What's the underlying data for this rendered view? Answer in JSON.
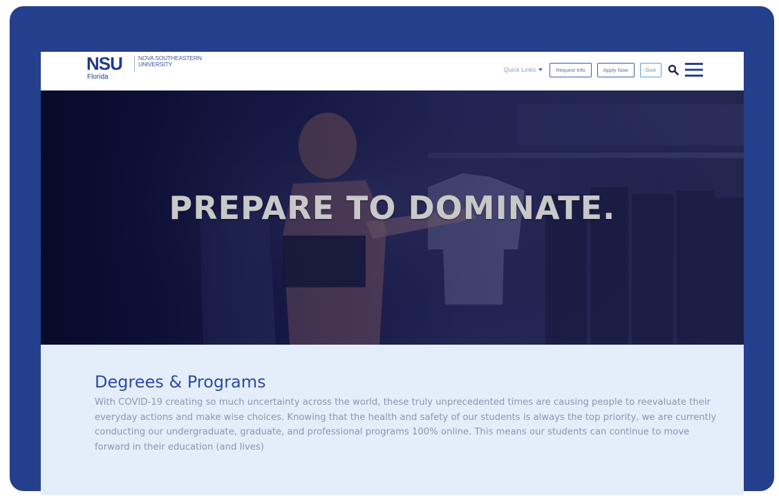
{
  "header": {
    "logo_mark": "NSU",
    "logo_name": "NOVA SOUTHEASTERN UNIVERSITY",
    "logo_sub": "Florida",
    "nav": {
      "quick_links": "Quick Links",
      "request_info": "Request Info",
      "apply_now": "Apply Now",
      "give": "Give"
    },
    "icons": {
      "search": "search-icon",
      "menu": "hamburger-menu-icon"
    }
  },
  "hero": {
    "title": "PREPARE TO DOMINATE."
  },
  "section": {
    "title": "Degrees & Programs",
    "body": "With COVID-19 creating so much uncertainty across the world, these truly unprecedented times are causing people to reevaluate their everyday actions and make wise choices. Knowing that the health and safety of our students is always the top priority, we are currently conducting our undergraduate, graduate, and professional programs 100% online. This means our students can continue to move forward in their education (and lives)"
  },
  "colors": {
    "frame": "#243f8b",
    "brand_blue": "#1e3a8f",
    "content_bg": "#e4eefb",
    "heading": "#2f4aa0"
  }
}
